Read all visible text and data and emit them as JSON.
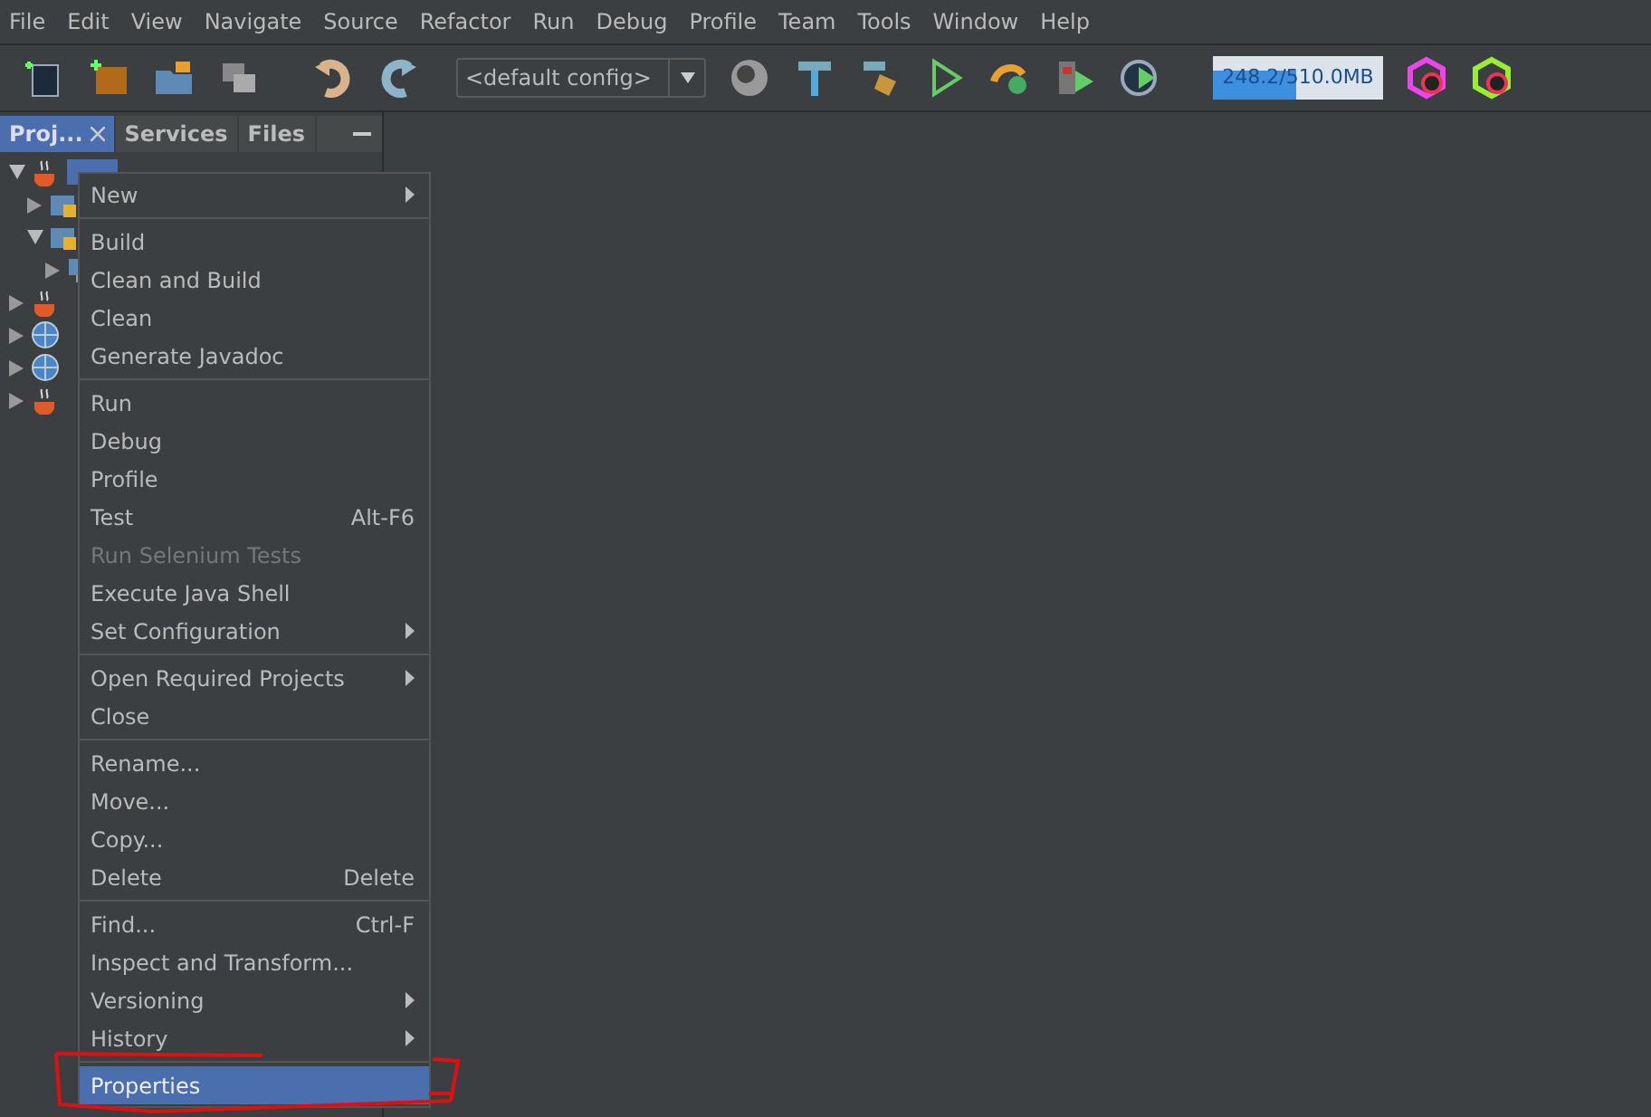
{
  "menu_bar": [
    {
      "label": "File"
    },
    {
      "label": "Edit"
    },
    {
      "label": "View"
    },
    {
      "label": "Navigate"
    },
    {
      "label": "Source"
    },
    {
      "label": "Refactor"
    },
    {
      "label": "Run"
    },
    {
      "label": "Debug"
    },
    {
      "label": "Profile"
    },
    {
      "label": "Team"
    },
    {
      "label": "Tools"
    },
    {
      "label": "Window"
    },
    {
      "label": "Help"
    }
  ],
  "toolbar": {
    "config": "<default config>",
    "memory": {
      "reading": "248.2/510.0MB",
      "level": 0.49
    }
  },
  "panel_tabs": [
    {
      "label": "Proj...",
      "selected": true,
      "closable": true
    },
    {
      "label": "Services",
      "selected": false,
      "closable": false
    },
    {
      "label": "Files",
      "selected": false,
      "closable": false
    }
  ],
  "tree": [
    {
      "kind": "project",
      "expanded": true,
      "selected": true,
      "children": [
        {
          "kind": "package",
          "expanded": false,
          "selected": false
        },
        {
          "kind": "package",
          "expanded": true,
          "selected": false,
          "children": [
            {
              "kind": "computer",
              "expanded": false,
              "selected": false
            }
          ]
        }
      ]
    },
    {
      "kind": "project",
      "expanded": false,
      "selected": false
    },
    {
      "kind": "web",
      "expanded": false,
      "selected": false
    },
    {
      "kind": "web",
      "expanded": false,
      "selected": false
    },
    {
      "kind": "project",
      "expanded": false,
      "selected": false
    }
  ],
  "context_menu": [
    [
      {
        "label": "New",
        "submenu": true,
        "selected": false,
        "disabled": false
      }
    ],
    [
      {
        "label": "Build",
        "selected": false,
        "disabled": false
      },
      {
        "label": "Clean and Build",
        "selected": false,
        "disabled": false
      },
      {
        "label": "Clean",
        "selected": false,
        "disabled": false
      },
      {
        "label": "Generate Javadoc",
        "selected": false,
        "disabled": false
      }
    ],
    [
      {
        "label": "Run",
        "selected": false,
        "disabled": false
      },
      {
        "label": "Debug",
        "selected": false,
        "disabled": false
      },
      {
        "label": "Profile",
        "selected": false,
        "disabled": false
      },
      {
        "label": "Test",
        "shortcut": "Alt-F6",
        "selected": false,
        "disabled": false
      },
      {
        "label": "Run Selenium Tests",
        "selected": false,
        "disabled": true
      },
      {
        "label": "Execute Java Shell",
        "selected": false,
        "disabled": false
      },
      {
        "label": "Set Configuration",
        "submenu": true,
        "selected": false,
        "disabled": false
      }
    ],
    [
      {
        "label": "Open Required Projects",
        "submenu": true,
        "selected": false,
        "disabled": false
      },
      {
        "label": "Close",
        "selected": false,
        "disabled": false
      }
    ],
    [
      {
        "label": "Rename...",
        "selected": false,
        "disabled": false
      },
      {
        "label": "Move...",
        "selected": false,
        "disabled": false
      },
      {
        "label": "Copy...",
        "selected": false,
        "disabled": false
      },
      {
        "label": "Delete",
        "shortcut": "Delete",
        "selected": false,
        "disabled": false
      }
    ],
    [
      {
        "label": "Find...",
        "shortcut": "Ctrl-F",
        "selected": false,
        "disabled": false
      },
      {
        "label": "Inspect and Transform...",
        "selected": false,
        "disabled": false
      },
      {
        "label": "Versioning",
        "submenu": true,
        "selected": false,
        "disabled": false
      },
      {
        "label": "History",
        "submenu": true,
        "selected": false,
        "disabled": false
      }
    ],
    [
      {
        "label": "Properties",
        "selected": true,
        "disabled": false
      }
    ]
  ]
}
